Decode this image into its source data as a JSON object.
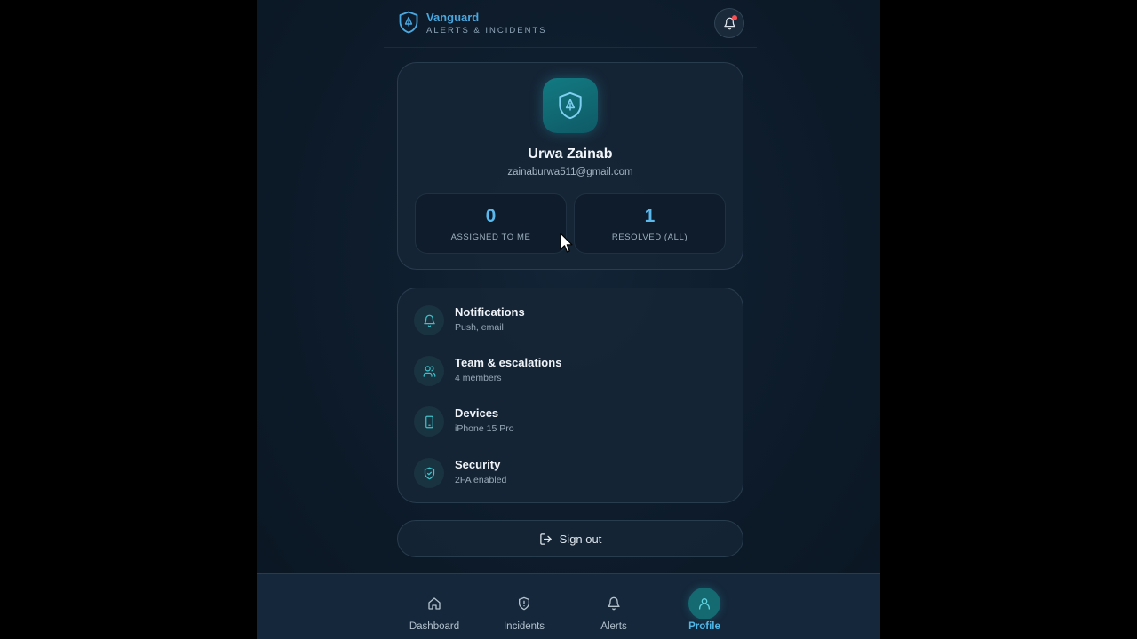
{
  "header": {
    "brand_name": "Vanguard",
    "brand_subtitle": "ALERTS & INCIDENTS",
    "icons": {
      "logo": "shield-icon",
      "notifications": "bell-icon"
    }
  },
  "profile": {
    "name": "Urwa Zainab",
    "email": "zainaburwa511@gmail.com",
    "avatar_icon": "shield-icon",
    "stats": [
      {
        "value": "0",
        "label": "ASSIGNED TO ME"
      },
      {
        "value": "1",
        "label": "RESOLVED (ALL)"
      }
    ]
  },
  "settings": {
    "items": [
      {
        "title": "Notifications",
        "subtitle": "Push, email",
        "icon": "bell-icon"
      },
      {
        "title": "Team & escalations",
        "subtitle": "4 members",
        "icon": "users-icon"
      },
      {
        "title": "Devices",
        "subtitle": "iPhone 15 Pro",
        "icon": "phone-icon"
      },
      {
        "title": "Security",
        "subtitle": "2FA enabled",
        "icon": "shield-check-icon"
      }
    ]
  },
  "signout": {
    "label": "Sign out",
    "icon": "logout-icon"
  },
  "nav": {
    "items": [
      {
        "label": "Dashboard",
        "icon": "home-icon"
      },
      {
        "label": "Incidents",
        "icon": "shield-alert-icon"
      },
      {
        "label": "Alerts",
        "icon": "bell-icon"
      },
      {
        "label": "Profile",
        "icon": "user-icon"
      }
    ],
    "active": "Profile"
  },
  "colors": {
    "accent": "#4aa8e0",
    "teal": "#156a72",
    "background": "#0d1b2a",
    "alert_dot": "#ff4d4f"
  }
}
